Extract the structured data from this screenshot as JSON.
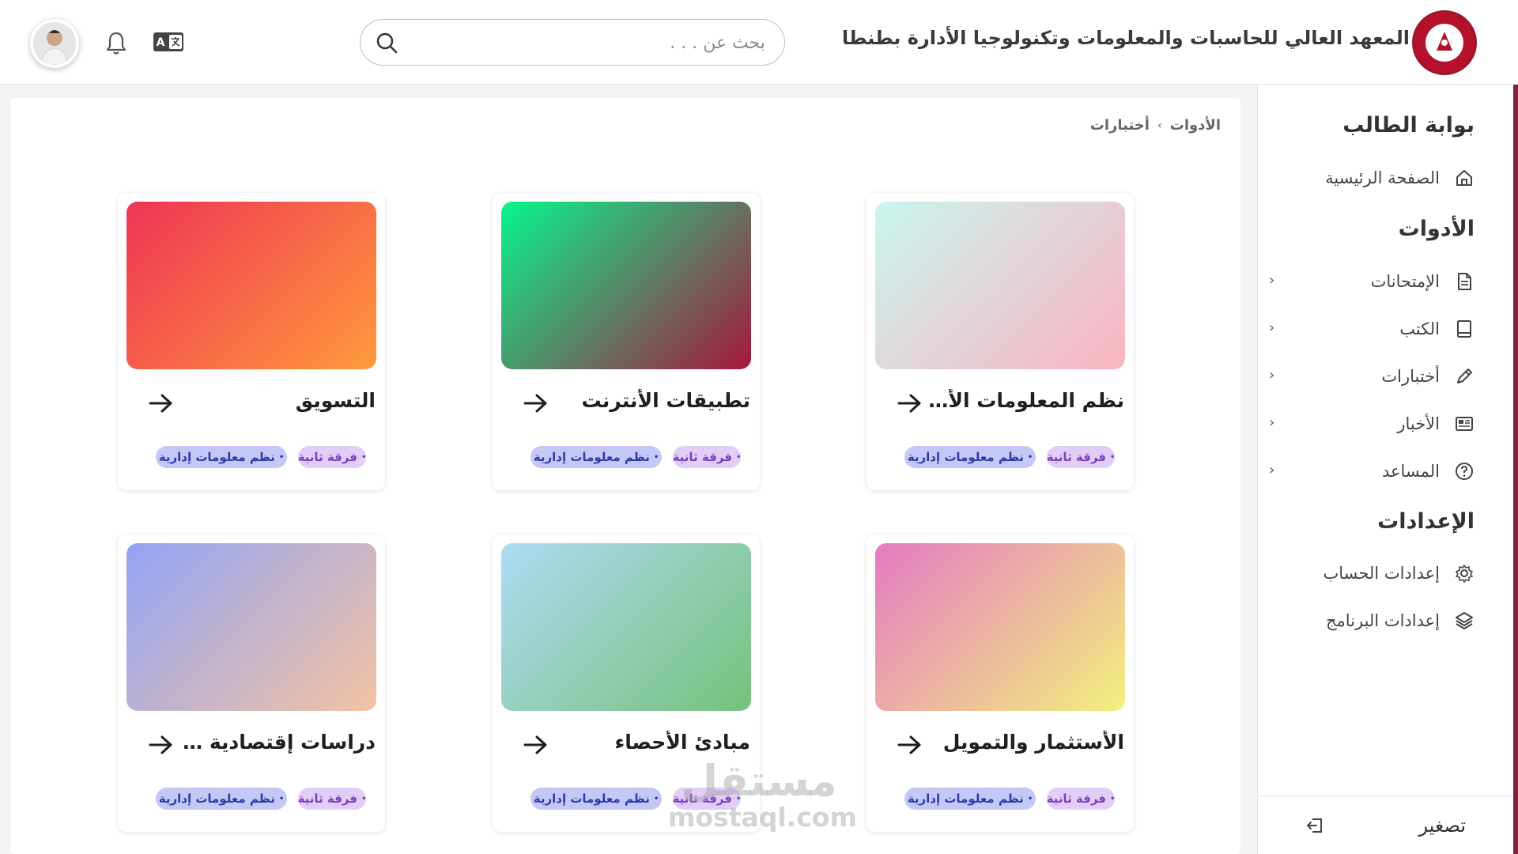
{
  "header": {
    "institute_name": "المعهد العالي للحاسبات والمعلومات وتكنولوجيا الأدارة بطنطا",
    "search_placeholder": "بحث عن . . .",
    "search_value": "",
    "lang_icon": "translate-icon",
    "bell_icon": "bell-icon"
  },
  "sidebar": {
    "portal_title": "بوابة الطالب",
    "home_label": "الصفحة الرئيسية",
    "tools_title": "الأدوات",
    "tools": [
      {
        "label": "الإمتحانات",
        "icon": "document-icon"
      },
      {
        "label": "الكتب",
        "icon": "book-icon"
      },
      {
        "label": "أختبارات",
        "icon": "pencil-icon"
      },
      {
        "label": "الأخبار",
        "icon": "news-icon"
      },
      {
        "label": "المساعد",
        "icon": "help-icon"
      }
    ],
    "settings_title": "الإعدادات",
    "settings": [
      {
        "label": "إعدادات الحساب",
        "icon": "gear-icon"
      },
      {
        "label": "إعدادات البرنامج",
        "icon": "layers-icon"
      }
    ],
    "collapse_label": "تصغير"
  },
  "breadcrumb": {
    "root": "الأدوات",
    "current": "أختبارات"
  },
  "cards": [
    {
      "title": "نظم المعلومات الأدارية",
      "year": "فرقة ثانية",
      "dept": "نظم معلومات إدارية",
      "colors": [
        "#c9f5ee",
        "#fbb3c2"
      ]
    },
    {
      "title": "تطبيقات الأنترنت",
      "year": "فرقة ثانية",
      "dept": "نظم معلومات إدارية",
      "colors": [
        "#08f58e",
        "#a6173e"
      ]
    },
    {
      "title": "التسويق",
      "year": "فرقة ثانية",
      "dept": "نظم معلومات إدارية",
      "colors": [
        "#ee3456",
        "#ff9a3b"
      ]
    },
    {
      "title": "الأستثمار والتمويل",
      "year": "فرقة ثانية",
      "dept": "نظم معلومات إدارية",
      "colors": [
        "#e47ac3",
        "#f3f07c"
      ]
    },
    {
      "title": "مبادئ الأحصاء",
      "year": "فرقة ثانية",
      "dept": "نظم معلومات إدارية",
      "colors": [
        "#aedbf5",
        "#76c17a"
      ]
    },
    {
      "title": "دراسات إقتصادية بالإنجليزية",
      "year": "فرقة ثانية",
      "dept": "نظم معلومات إدارية",
      "colors": [
        "#92a3f5",
        "#f3c3a3"
      ]
    }
  ],
  "watermark": {
    "arabic": "مستقل",
    "latin": "mostaql.com"
  }
}
